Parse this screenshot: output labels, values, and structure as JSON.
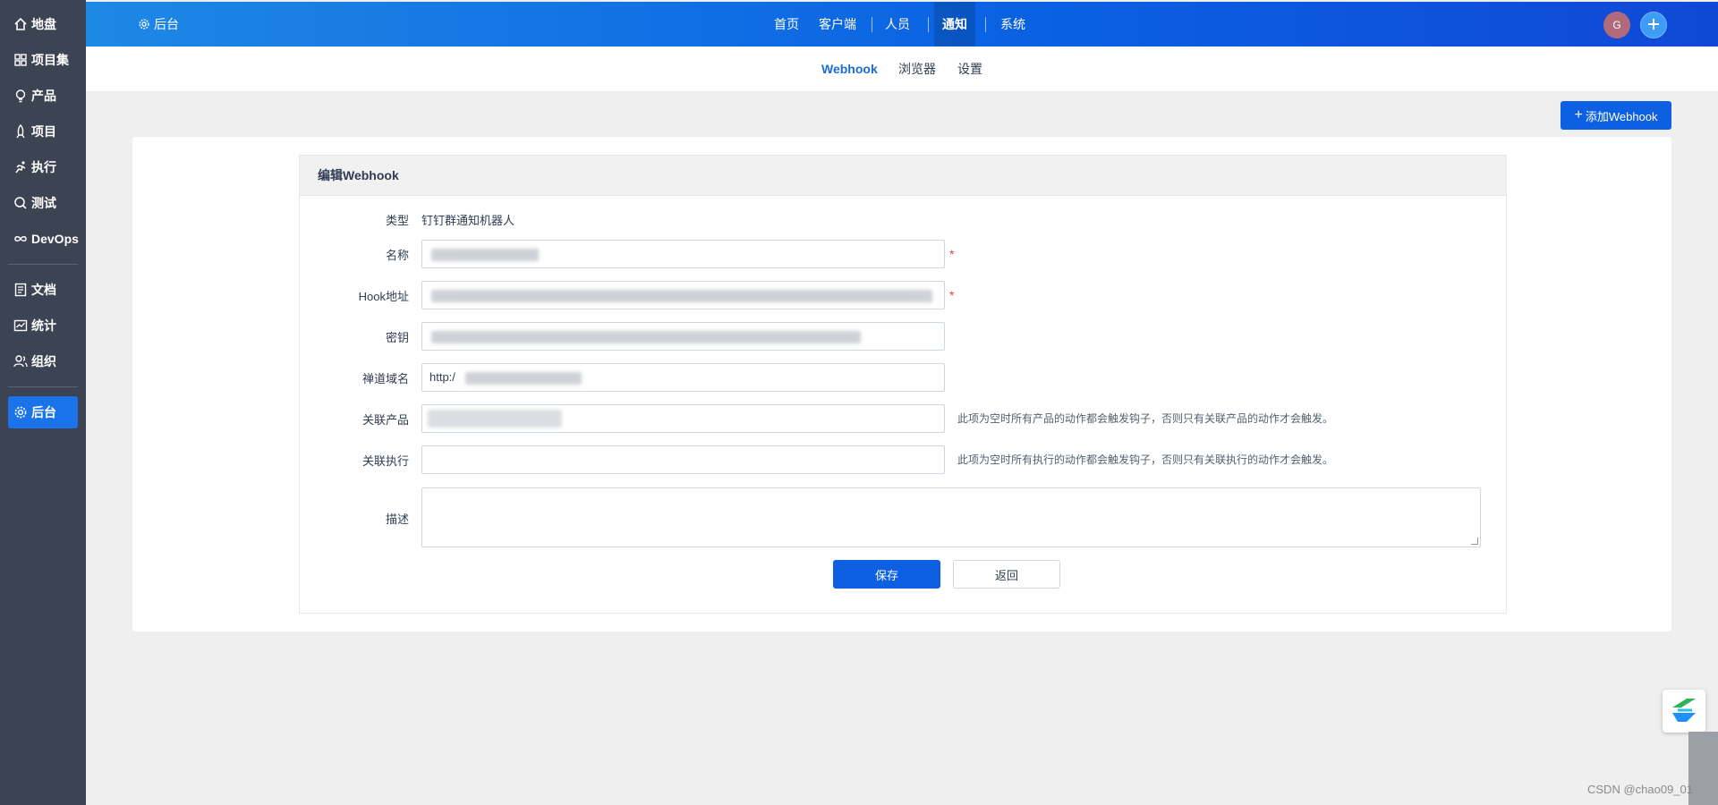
{
  "sidebar": {
    "items": [
      {
        "label": "地盘",
        "icon": "home-icon"
      },
      {
        "label": "项目集",
        "icon": "grid-icon"
      },
      {
        "label": "产品",
        "icon": "bulb-icon"
      },
      {
        "label": "项目",
        "icon": "rocket-icon"
      },
      {
        "label": "执行",
        "icon": "run-icon"
      },
      {
        "label": "测试",
        "icon": "magnifier-icon"
      },
      {
        "label": "DevOps",
        "icon": "infinity-icon"
      },
      {
        "label": "文档",
        "icon": "document-icon"
      },
      {
        "label": "统计",
        "icon": "chart-icon"
      },
      {
        "label": "组织",
        "icon": "people-icon"
      },
      {
        "label": "后台",
        "icon": "gear-icon",
        "active": true
      }
    ]
  },
  "topbar": {
    "title": "后台",
    "nav": [
      "首页",
      "客户端",
      "人员",
      "通知",
      "系统"
    ],
    "active_nav": "通知",
    "avatar_letter": "G"
  },
  "subnav": {
    "items": [
      "Webhook",
      "浏览器",
      "设置"
    ],
    "active": "Webhook"
  },
  "add_button": "添加Webhook",
  "form": {
    "header": "编辑Webhook",
    "type_label": "类型",
    "type_value": "钉钉群通知机器人",
    "name_label": "名称",
    "name_value": "",
    "hook_label": "Hook地址",
    "hook_value": "",
    "secret_label": "密钥",
    "secret_value": "",
    "domain_label": "禅道域名",
    "domain_value": "http:/",
    "product_label": "关联产品",
    "product_hint": "此项为空时所有产品的动作都会触发钩子，否则只有关联产品的动作才会触发。",
    "execution_label": "关联执行",
    "execution_hint": "此项为空时所有执行的动作都会触发钩子，否则只有关联执行的动作才会触发。",
    "desc_label": "描述",
    "required_mark": "*",
    "save_label": "保存",
    "back_label": "返回"
  },
  "watermark": "CSDN @chao09_01",
  "colors": {
    "sidebar_bg": "#3c4353",
    "accent": "#0c60e1",
    "active_sub": "#1a6cd6",
    "required": "#e04040"
  }
}
